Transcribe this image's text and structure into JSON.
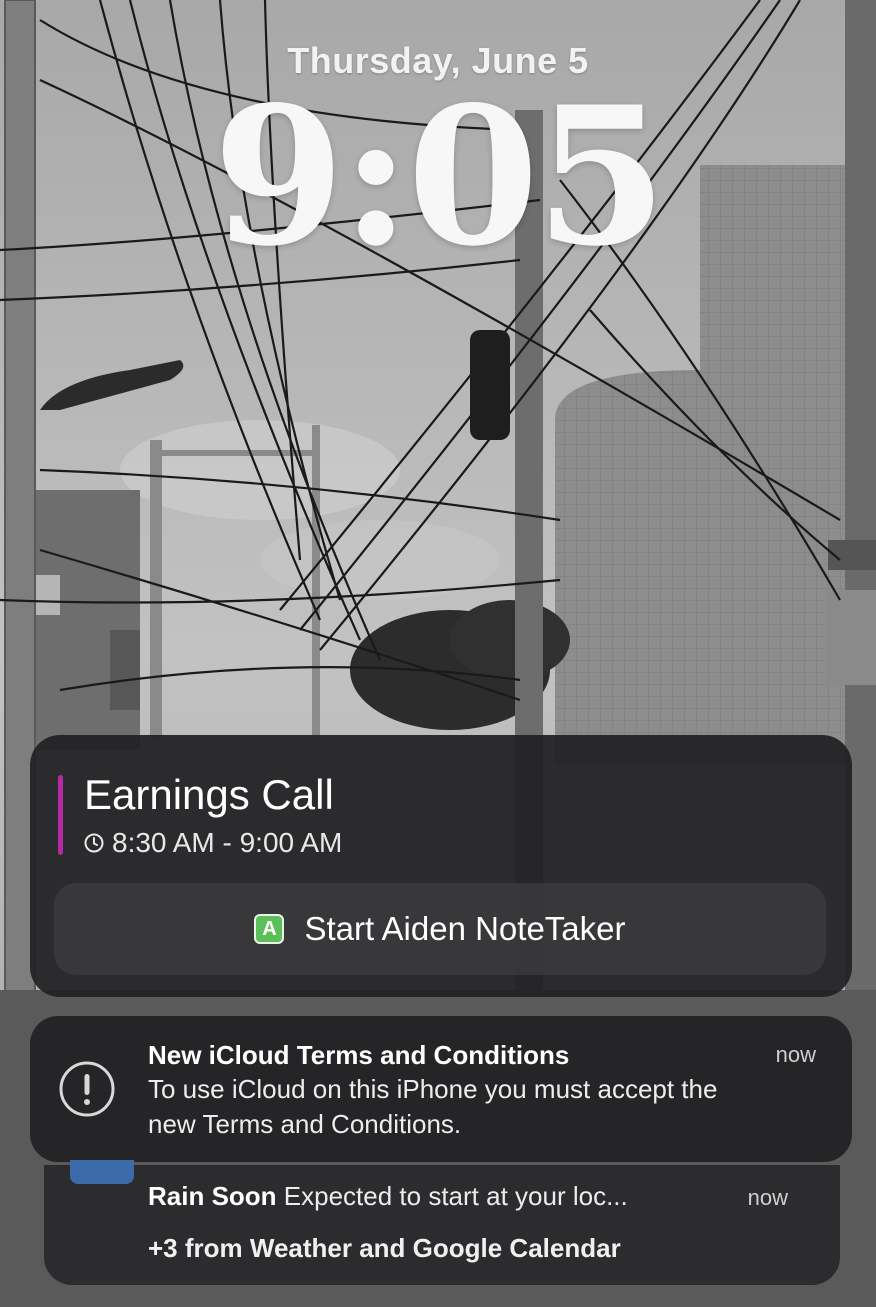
{
  "lockscreen": {
    "date": "Thursday, June 5",
    "time": "9:05"
  },
  "event_notification": {
    "title": "Earnings Call",
    "time_range": "8:30 AM - 9:00 AM",
    "accent_color": "#b12ca3",
    "icon": "clock-icon",
    "action": {
      "app_letter": "A",
      "label": "Start Aiden NoteTaker"
    }
  },
  "icloud_notification": {
    "icon": "alert-circle-icon",
    "title": "New iCloud Terms and Conditions",
    "body": "To use iCloud on this iPhone you must accept the new Terms and Conditions.",
    "time": "now"
  },
  "weather_notification": {
    "title": "Rain Soon",
    "body": "Expected to start at your loc...",
    "time": "now",
    "more": "+3 from Weather and Google Calendar"
  }
}
